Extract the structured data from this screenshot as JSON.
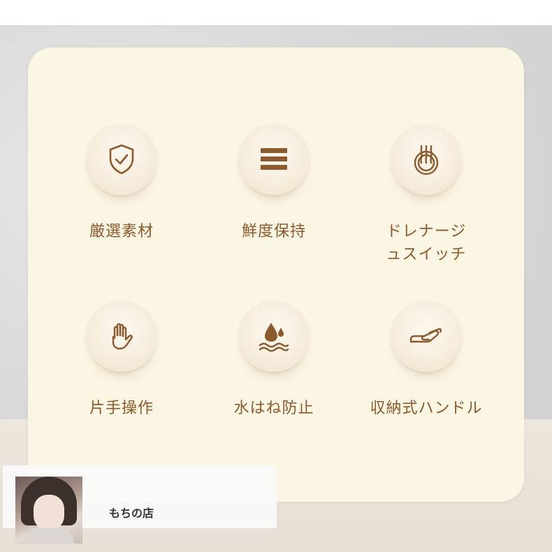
{
  "features": [
    {
      "label": "厳選素材",
      "icon": "shield-check-icon"
    },
    {
      "label": "鮮度保持",
      "icon": "layers-icon"
    },
    {
      "label": "ドレナージ\nュスイッチ",
      "icon": "steam-switch-icon"
    },
    {
      "label": "片手操作",
      "icon": "hand-icon"
    },
    {
      "label": "水はね防止",
      "icon": "water-drop-icon"
    },
    {
      "label": "収納式ハンドル",
      "icon": "handle-icon"
    }
  ],
  "shop": {
    "name": "もちの店"
  },
  "colors": {
    "card": "#fbf5e4",
    "icon": "#8b5a2e",
    "text": "#8b5a2e",
    "background": "#d9d9d9"
  }
}
